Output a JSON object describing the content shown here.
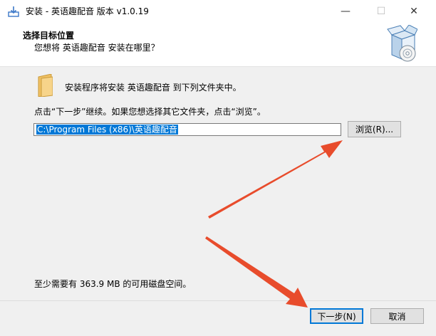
{
  "window": {
    "title": "安装 - 英语趣配音 版本 v1.0.19",
    "minimize": "—",
    "maximize": "☐",
    "close": "✕"
  },
  "header": {
    "title": "选择目标位置",
    "subtitle": "您想将 英语趣配音 安装在哪里？"
  },
  "main": {
    "install_text": "安装程序将安装 英语趣配音 到下列文件夹中。",
    "instruction": "点击“下一步”继续。如果您想选择其它文件夹，点击“浏览”。",
    "path_value": "C:\\Program Files (x86)\\英语趣配音",
    "browse_label": "浏览(R)...",
    "space_required": "至少需要有 363.9 MB 的可用磁盘空间。"
  },
  "footer": {
    "next_label": "下一步(N)",
    "cancel_label": "取消"
  },
  "colors": {
    "accent": "#0078d7",
    "annotation_arrow": "#e84c2c"
  },
  "icons": {
    "title": "installer-icon",
    "header": "software-box-cd-icon",
    "folder": "folder-icon"
  }
}
